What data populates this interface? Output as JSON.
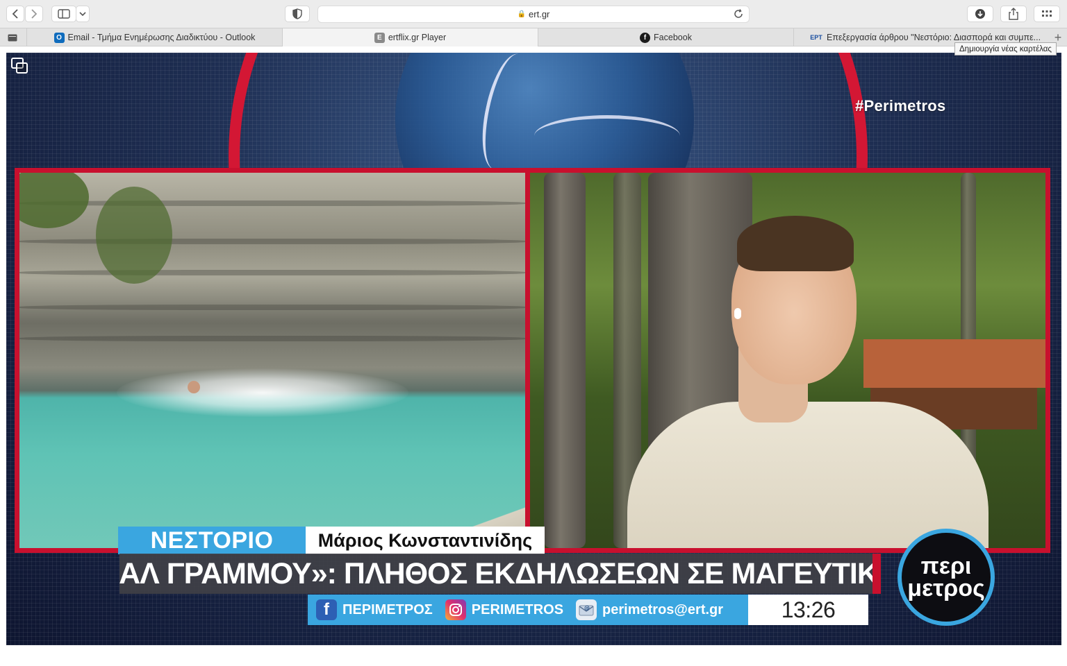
{
  "browser": {
    "address": "ert.gr",
    "tabs": [
      {
        "label": "Email - Τμήμα Ενημέρωσης Διαδικτύου - Outlook",
        "favicon_letter": "O"
      },
      {
        "label": "ertflix.gr Player",
        "favicon_letter": "E"
      },
      {
        "label": "Facebook",
        "favicon_letter": "f"
      },
      {
        "label": "Επεξεργασία άρθρου \"Νεστόριο: Διασπορά και συμπε...",
        "favicon_letter": "EPT"
      }
    ],
    "new_tab_tooltip": "Δημιουργία νέας καρτέλας",
    "colors": {
      "outlook": "#0f6cbd",
      "ertflix": "#8a8a8a",
      "facebook": "#1b1b1b",
      "ert": "#1b4fa0"
    }
  },
  "broadcast": {
    "hashtag": "#Perimetros",
    "location": "ΝΕΣΤΟΡΙΟ",
    "reporter": "Μάριος Κωνσταντινίδης",
    "headline": "«ΦΕΣΤΙΒΑΛ ΓΡΑΜΜΟΥ»: ΠΛΗΘΟΣ ΕΚΔΗΛΩΣΕΩΝ ΣΕ ΜΑΓΕΥΤΙΚΑ ΤΟΠΙΑ",
    "social": {
      "facebook": "ΠΕΡΙΜΕΤΡΟΣ",
      "instagram": "PERIMETROS",
      "email": "perimetros@ert.gr"
    },
    "clock": "13:26",
    "logo_line1": "περι",
    "logo_line2": "μετρος",
    "colors": {
      "accent_red": "#c8102e",
      "accent_blue": "#3aa6e0"
    }
  }
}
